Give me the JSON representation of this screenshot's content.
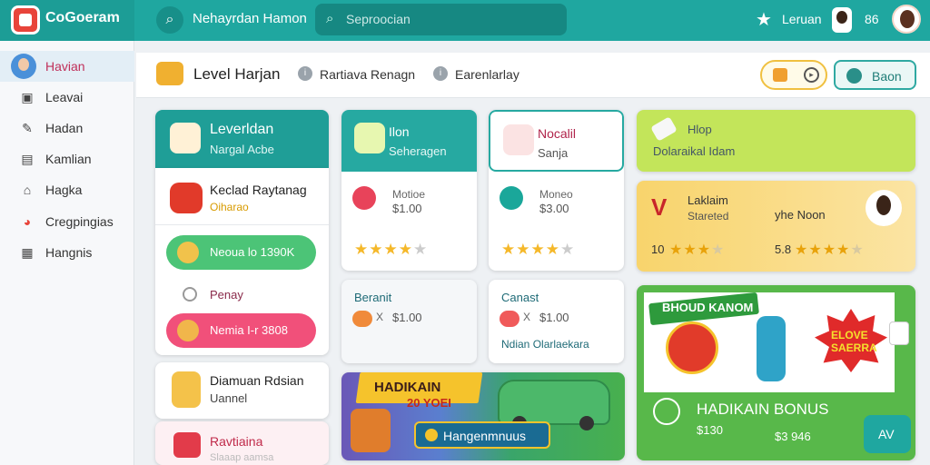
{
  "topbar": {
    "app_name": "CoGoeram",
    "title": "Nehayrdan Hamon",
    "search_placeholder": "Seproocian",
    "user_label": "Leruan",
    "count": "86",
    "icons": [
      "search-icon",
      "star-icon",
      "avatar"
    ]
  },
  "sidebar": {
    "items": [
      {
        "label": "Havian",
        "icon": "avatar",
        "active": true
      },
      {
        "label": "Leavai",
        "icon": "box-icon"
      },
      {
        "label": "Hadan",
        "icon": "edit-icon"
      },
      {
        "label": "Kamlian",
        "icon": "document-icon"
      },
      {
        "label": "Hagka",
        "icon": "home-icon"
      },
      {
        "label": "Cregpingias",
        "icon": "chart-icon"
      },
      {
        "label": "Hangnis",
        "icon": "calendar-icon"
      }
    ]
  },
  "subheader": {
    "title": "Level Harjan",
    "link1": "Rartiava Renagn",
    "link2": "Earenlarlay",
    "button_label": "Baon"
  },
  "col1": {
    "head_title": "Leverldan",
    "head_sub": "Nargal Acbe",
    "item_title": "Keclad Raytanag",
    "item_sub": "Oiharao",
    "green_label": "Neoua lo 1390K",
    "mid_label": "Penay",
    "pink_label": "Nemia I-r 3808",
    "b2_title": "Diamuan Rdsian",
    "b2_sub": "Uannel",
    "b3_title": "Ravtiaina",
    "b3_sub": "Slaaap aamsa"
  },
  "cards": {
    "c2": {
      "title": "Ilon",
      "sub": "Seheragen",
      "label": "Motioe",
      "price": "$1.00",
      "stars": 4
    },
    "c3": {
      "title": "Nocalil",
      "sub": "Sanja",
      "label": "Moneo",
      "price": "$3.00",
      "stars": 4
    },
    "l2": {
      "title": "Beranit",
      "x": "X",
      "price": "$1.00"
    },
    "l3": {
      "title": "Canast",
      "x": "X",
      "price": "$1.00",
      "foot": "Ndian Olarlaekara"
    }
  },
  "banner": {
    "title": "HADIKAIN",
    "year": "20 YOEI",
    "button_label": "Hangenmnuus"
  },
  "right": {
    "green_title": "Hlop",
    "green_sub": "Dolaraikal Idam",
    "yellow_logo": "V",
    "yellow_title": "Laklaim",
    "yellow_sub": "Stareted",
    "yellow_mid": "yhe Noon",
    "rate1": "10",
    "rate2": "5.8",
    "stars1": 3,
    "stars2": 4,
    "promo_ribbon": "BHOUD KANOM",
    "promo_badge": "ELOVE SAERRA",
    "promo_title": "HADIKAIN BONUS",
    "promo_price1": "$130",
    "promo_price2": "$3 946",
    "promo_button": "AV"
  },
  "colors": {
    "teal": "#1fa7a0",
    "green": "#4cc477",
    "pink": "#f1507a",
    "lime": "#c3e55a",
    "yellow": "#f8d46c"
  }
}
